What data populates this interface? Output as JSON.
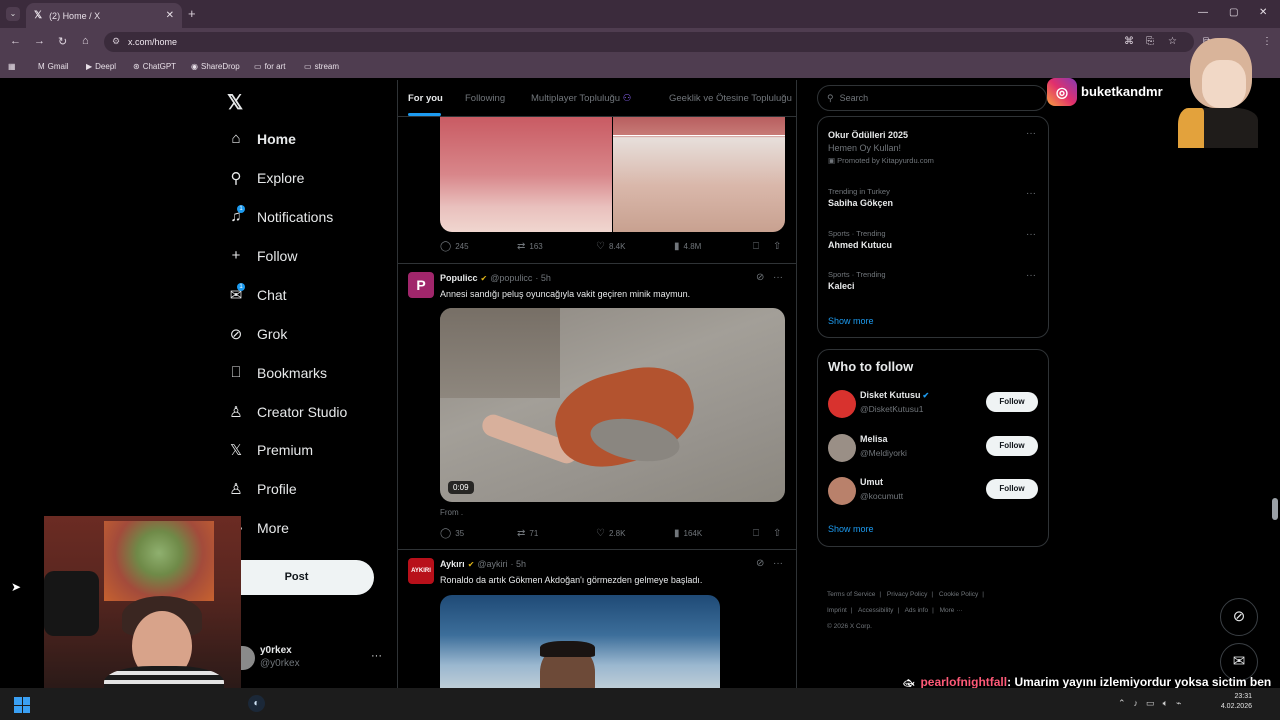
{
  "browser": {
    "tab_title": "(2) Home / X",
    "tab_close": "✕",
    "new_tab": "+",
    "url": "x.com/home",
    "window_controls": [
      "—",
      "▢",
      "✕"
    ],
    "bookmarks": [
      {
        "label": "Gmail",
        "icon": "M"
      },
      {
        "label": "Deepl",
        "icon": "▶"
      },
      {
        "label": "ChatGPT",
        "icon": "⊛"
      },
      {
        "label": "ShareDrop",
        "icon": "◉"
      },
      {
        "label": "for art",
        "icon": "▭"
      },
      {
        "label": "stream",
        "icon": "▭"
      }
    ]
  },
  "sidebar": {
    "logo": "𝕏",
    "items": [
      {
        "label": "Home",
        "icon": "⌂",
        "badge": ""
      },
      {
        "label": "Explore",
        "icon": "⚲",
        "badge": ""
      },
      {
        "label": "Notifications",
        "icon": "🔔︎",
        "badge": "1"
      },
      {
        "label": "Follow",
        "icon": "+",
        "badge": ""
      },
      {
        "label": "Chat",
        "icon": "✉",
        "badge": "1"
      },
      {
        "label": "Grok",
        "icon": "⊘",
        "badge": ""
      },
      {
        "label": "Bookmarks",
        "icon": "⎕",
        "badge": ""
      },
      {
        "label": "Creator Studio",
        "icon": "♙",
        "badge": ""
      },
      {
        "label": "Premium",
        "icon": "𝕏",
        "badge": ""
      },
      {
        "label": "Profile",
        "icon": "♙",
        "badge": ""
      },
      {
        "label": "More",
        "icon": "⋯",
        "badge": ""
      }
    ],
    "post_label": "Post",
    "account": {
      "name": "y0rkex",
      "handle": "@y0rkex",
      "more": "···"
    }
  },
  "timeline": {
    "tabs": [
      "For you",
      "Following",
      "Multiplayer Topluluğu",
      "Geeklik ve Ötesine Topluluğu"
    ],
    "tweets": [
      {
        "actions": {
          "replies": "245",
          "reposts": "163",
          "likes": "8.4K",
          "views": "4.8M"
        }
      },
      {
        "name": "Populicc",
        "handle": "@populicc",
        "time": "· 5h",
        "text": "Annesi sandığı peluş oyuncağıyla vakit geçiren minik maymun.",
        "video_time": "0:09",
        "source": "From .",
        "actions": {
          "replies": "35",
          "reposts": "71",
          "likes": "2.8K",
          "views": "164K"
        }
      },
      {
        "name": "Aykırı",
        "handle": "@aykiri",
        "time": "· 5h",
        "text": "Ronaldo da artık Gökmen Akdoğan'ı görmezden gelmeye başladı."
      }
    ]
  },
  "right": {
    "search_placeholder": "Search",
    "trends": [
      {
        "meta": "",
        "title": "Okur Ödülleri 2025",
        "sub": "Hemen Oy Kullan!",
        "promo": "Promoted by Kitapyurdu.com"
      },
      {
        "meta": "Trending in Turkey",
        "title": "Sabiha Gökçen"
      },
      {
        "meta": "Sports · Trending",
        "title": "Ahmed Kutucu"
      },
      {
        "meta": "Sports · Trending",
        "title": "Kaleci"
      }
    ],
    "show_more": "Show more",
    "who_to_follow": "Who to follow",
    "follow_users": [
      {
        "name": "Disket Kutusu",
        "handle": "@DisketKutusu1",
        "verified": true,
        "color": "#d8322e"
      },
      {
        "name": "Melisa",
        "handle": "@Meldiyorki",
        "verified": false,
        "color": "#9a8f86"
      },
      {
        "name": "Umut",
        "handle": "@kocumutt",
        "verified": false,
        "color": "#b9816b"
      }
    ],
    "follow_label": "Follow",
    "footer": [
      "Terms of Service",
      "|",
      "Privacy Policy",
      "|",
      "Cookie Policy",
      "|",
      "Imprint",
      "|",
      "Accessibility",
      "|",
      "Ads info",
      "|",
      "More ···",
      "© 2026 X Corp."
    ]
  },
  "overlay": {
    "instagram_name": "buketkandmr",
    "chat_user": "pearlofnightfall",
    "chat_message": ": Umarim yayını izlemiyordur yoksa sictim ben unuttum apalsnapamna"
  },
  "taskbar": {
    "time": "23:31",
    "date": "4.02.2026"
  },
  "colors": {
    "accent": "#1d9bf0",
    "background": "#000000",
    "chrome": "#4f3d50"
  }
}
